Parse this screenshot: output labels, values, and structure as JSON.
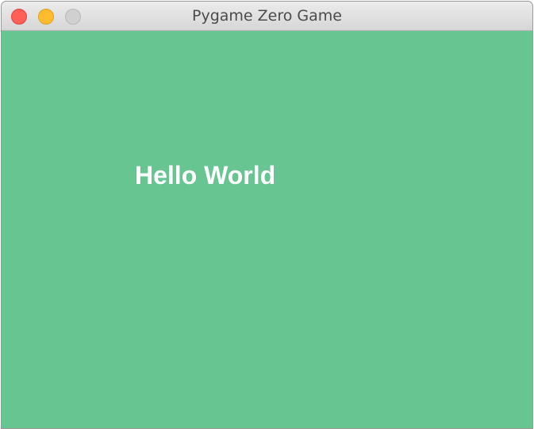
{
  "window": {
    "title": "Pygame Zero Game",
    "controls": {
      "close_icon": "close-icon",
      "minimize_icon": "minimize-icon",
      "zoom_icon": "zoom-icon"
    },
    "colors": {
      "close": "#fe5f57",
      "minimize": "#febc2e",
      "zoom_disabled": "#d0d0d0"
    }
  },
  "game": {
    "background_color": "#66c591",
    "text": "Hello World",
    "text_color": "#ffffff"
  }
}
